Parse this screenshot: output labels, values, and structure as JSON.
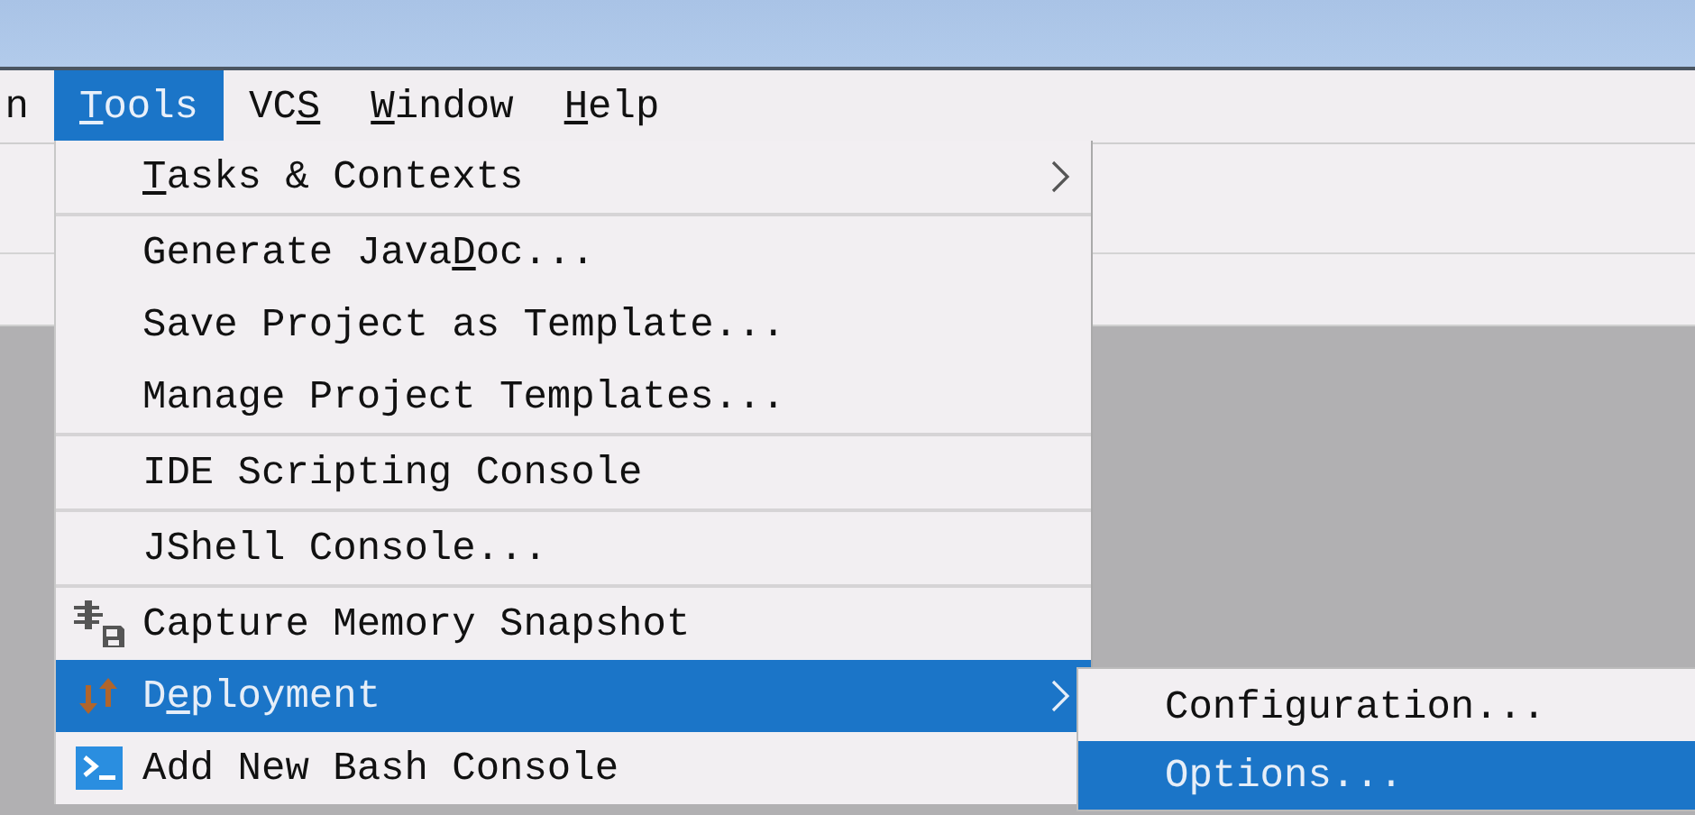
{
  "menu_bar": [
    {
      "label": [
        {
          "text": "n",
          "underlined": false
        }
      ],
      "selected": false
    },
    {
      "label": [
        {
          "text": "T",
          "underlined": true
        },
        {
          "text": "ools",
          "underlined": false
        }
      ],
      "selected": true
    },
    {
      "label": [
        {
          "text": "VC",
          "underlined": false
        },
        {
          "text": "S",
          "underlined": true
        }
      ],
      "selected": false
    },
    {
      "label": [
        {
          "text": "W",
          "underlined": true
        },
        {
          "text": "indow",
          "underlined": false
        }
      ],
      "selected": false
    },
    {
      "label": [
        {
          "text": "H",
          "underlined": true
        },
        {
          "text": "elp",
          "underlined": false
        }
      ],
      "selected": false
    }
  ],
  "tools_menu": {
    "groups": [
      [
        {
          "label": [
            {
              "text": "T",
              "underlined": true
            },
            {
              "text": "asks & Contexts",
              "underlined": false
            }
          ],
          "submenu": true,
          "selected": false
        }
      ],
      [
        {
          "label": [
            {
              "text": "Generate Java",
              "underlined": false
            },
            {
              "text": "D",
              "underlined": true
            },
            {
              "text": "oc...",
              "underlined": false
            }
          ],
          "submenu": false,
          "selected": false
        },
        {
          "label": [
            {
              "text": "Save Project as Template...",
              "underlined": false
            }
          ],
          "submenu": false,
          "selected": false
        },
        {
          "label": [
            {
              "text": "Manage Project Templates...",
              "underlined": false
            }
          ],
          "submenu": false,
          "selected": false
        }
      ],
      [
        {
          "label": [
            {
              "text": "IDE Scripting Console",
              "underlined": false
            }
          ],
          "submenu": false,
          "selected": false
        }
      ],
      [
        {
          "label": [
            {
              "text": "JShell Console...",
              "underlined": false
            }
          ],
          "submenu": false,
          "selected": false
        }
      ],
      [
        {
          "kind": "memory",
          "label": [
            {
              "text": "Capture Memory Snapshot",
              "underlined": false
            }
          ],
          "submenu": false,
          "selected": false
        },
        {
          "kind": "deploy",
          "label": [
            {
              "text": "D",
              "underlined": false
            },
            {
              "text": "e",
              "underlined": true
            },
            {
              "text": "ployment",
              "underlined": false
            }
          ],
          "submenu": true,
          "selected": true
        },
        {
          "kind": "bash",
          "label": [
            {
              "text": "Add New Bash Console",
              "underlined": false
            }
          ],
          "submenu": false,
          "selected": false
        }
      ]
    ]
  },
  "deployment_submenu": {
    "items": [
      {
        "label": "Configuration...",
        "selected": false
      },
      {
        "label": "Options...",
        "selected": true
      }
    ]
  }
}
